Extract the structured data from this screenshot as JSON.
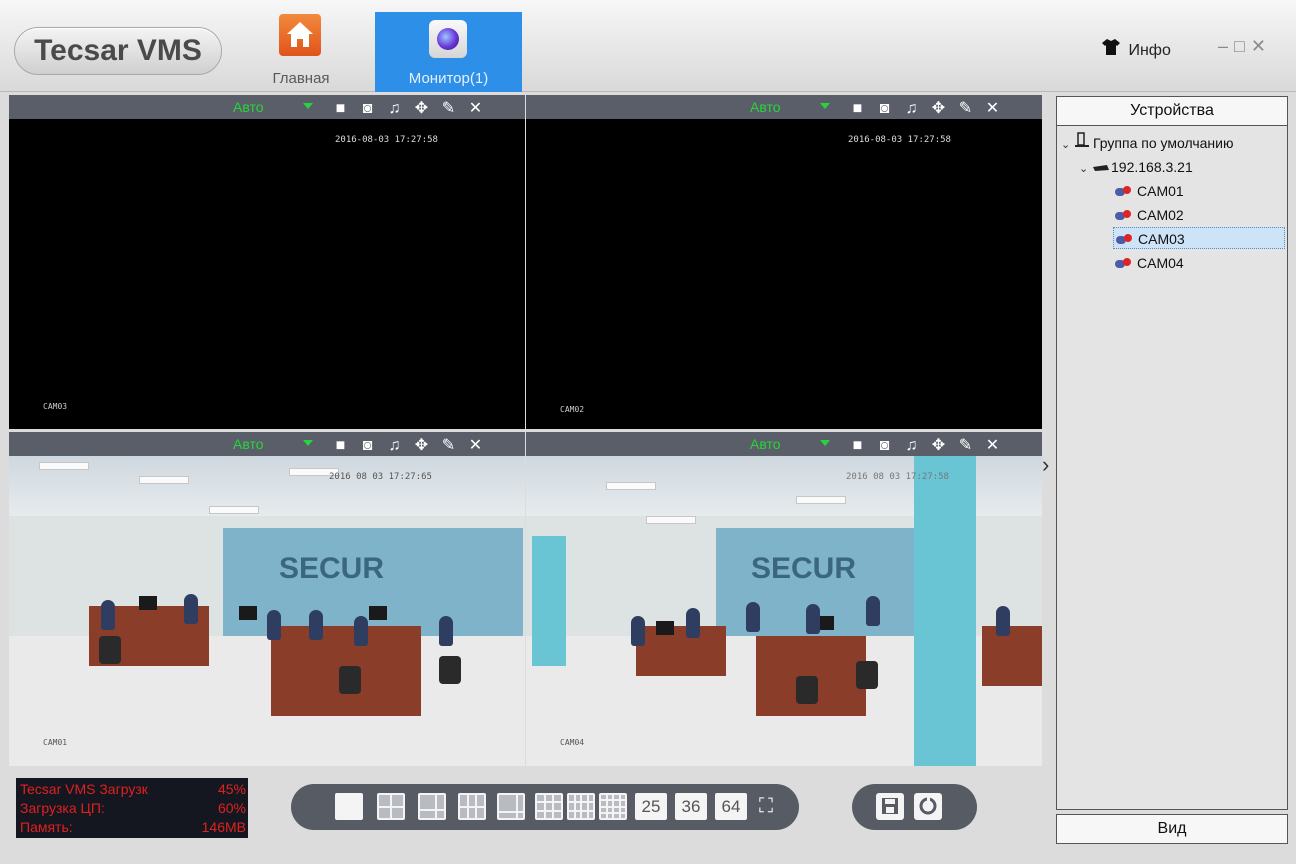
{
  "app": {
    "logo": "Tecsar VMS"
  },
  "nav": {
    "home_label": "Главная",
    "monitor_label": "Монитор(1)"
  },
  "header": {
    "info_label": "Инфо"
  },
  "panes": [
    {
      "mode": "Авто",
      "timestamp": "2016-08-03 17:27:58",
      "camera_label": "CAM03"
    },
    {
      "mode": "Авто",
      "timestamp": "2016-08-03 17:27:58",
      "camera_label": "CAM02"
    },
    {
      "mode": "Авто",
      "timestamp": "2016 08 03 17:27:65",
      "camera_label": "CAM01"
    },
    {
      "mode": "Авто",
      "timestamp": "2016 08 03 17:27:58",
      "camera_label": "CAM04",
      "brand_text": "SECUR"
    }
  ],
  "scene_brand": "SECUR",
  "sidebar": {
    "devices_title": "Устройства",
    "group_label": "Группа по умолчанию",
    "device_ip": "192.168.3.21",
    "cameras": [
      "CAM01",
      "CAM02",
      "CAM03",
      "CAM04"
    ],
    "selected_camera": "CAM03",
    "view_label": "Вид"
  },
  "status": {
    "rows": [
      {
        "label": "Tecsar VMS Загрузк",
        "value": "45%"
      },
      {
        "label": "Загрузка ЦП:",
        "value": "60%"
      },
      {
        "label": "Память:",
        "value": "146MB"
      }
    ]
  },
  "layout_toolbar": {
    "grid_counts": [
      "25",
      "36",
      "64"
    ]
  },
  "colors": {
    "accent": "#2e8fe8",
    "ok_green": "#27d53a",
    "alert_red": "#e02020",
    "toolbar_dark": "#565b64"
  }
}
